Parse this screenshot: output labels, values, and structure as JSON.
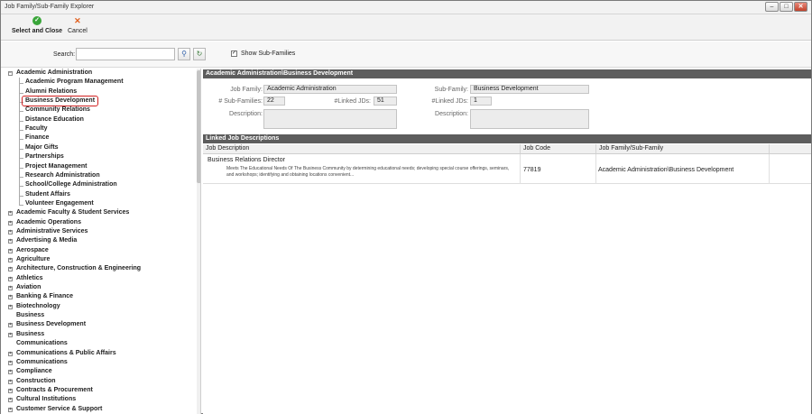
{
  "window": {
    "title": "Job Family/Sub-Family Explorer"
  },
  "toolbar": {
    "select_label": "Select and Close",
    "cancel_label": "Cancel"
  },
  "search": {
    "label": "Search:",
    "value": "",
    "placeholder": "",
    "show_subfamilies_label": "Show Sub-Families",
    "show_subfamilies_checked": true
  },
  "tree": {
    "parent": "Academic Administration",
    "children": [
      "Academic Program Management",
      "Alumni Relations",
      "Business Development",
      "Community Relations",
      "Distance Education",
      "Faculty",
      "Finance",
      "Major Gifts",
      "Partnerships",
      "Project Management",
      "Research Administration",
      "School/College Administration",
      "Student Affairs",
      "Volunteer Engagement"
    ],
    "selected": "Business Development",
    "families": [
      {
        "label": "Academic Faculty & Student Services",
        "expandable": true
      },
      {
        "label": "Academic Operations",
        "expandable": true
      },
      {
        "label": "Administrative Services",
        "expandable": true
      },
      {
        "label": "Advertising & Media",
        "expandable": true
      },
      {
        "label": "Aerospace",
        "expandable": true
      },
      {
        "label": "Agriculture",
        "expandable": true
      },
      {
        "label": "Architecture, Construction & Engineering",
        "expandable": true
      },
      {
        "label": "Athletics",
        "expandable": true
      },
      {
        "label": "Aviation",
        "expandable": true
      },
      {
        "label": "Banking & Finance",
        "expandable": true
      },
      {
        "label": "Biotechnology",
        "expandable": true
      },
      {
        "label": "Business",
        "expandable": false
      },
      {
        "label": "Business Development",
        "expandable": true
      },
      {
        "label": "Business",
        "expandable": true
      },
      {
        "label": "Communications",
        "expandable": false
      },
      {
        "label": "Communications & Public Affairs",
        "expandable": true
      },
      {
        "label": "Communications",
        "expandable": true
      },
      {
        "label": "Compliance",
        "expandable": true
      },
      {
        "label": "Construction",
        "expandable": true
      },
      {
        "label": "Contracts & Procurement",
        "expandable": true
      },
      {
        "label": "Cultural Institutions",
        "expandable": true
      },
      {
        "label": "Customer Service & Support",
        "expandable": true
      }
    ]
  },
  "detail": {
    "header": "Academic Administration\\Business Development",
    "job_family_label": "Job Family:",
    "job_family_value": "Academic Administration",
    "sub_families_label": "# Sub-Families:",
    "sub_families_value": "22",
    "linked_jds_label": "#Linked JDs:",
    "linked_jds_value": "51",
    "description_label": "Description:",
    "sub_family_label": "Sub-Family:",
    "sub_family_value": "Business Development",
    "sub_linked_jds_label": "#Linked JDs:",
    "sub_linked_jds_value": "1",
    "sub_description_label": "Description:"
  },
  "linked": {
    "header": "Linked Job Descriptions",
    "columns": [
      "Job Description",
      "Job Code",
      "Job Family/Sub-Family"
    ],
    "rows": [
      {
        "title": "Business Relations Director",
        "description": "Meets The Educational Needs Of The Business Community  by determining educational needs; developing special course offerings, seminars, and workshops; identifying and obtaining locations convenient...",
        "code": "77819",
        "family": "Academic Administration\\Business Development"
      }
    ]
  },
  "icons": {
    "select": "check-circle-icon",
    "cancel": "x-icon",
    "search": "magnifier-icon",
    "refresh": "refresh-icon"
  },
  "colors": {
    "section_header": "#5d5d5d",
    "selected_outline": "#d02020",
    "accept": "#3aa63a",
    "cancel": "#e0601e"
  }
}
